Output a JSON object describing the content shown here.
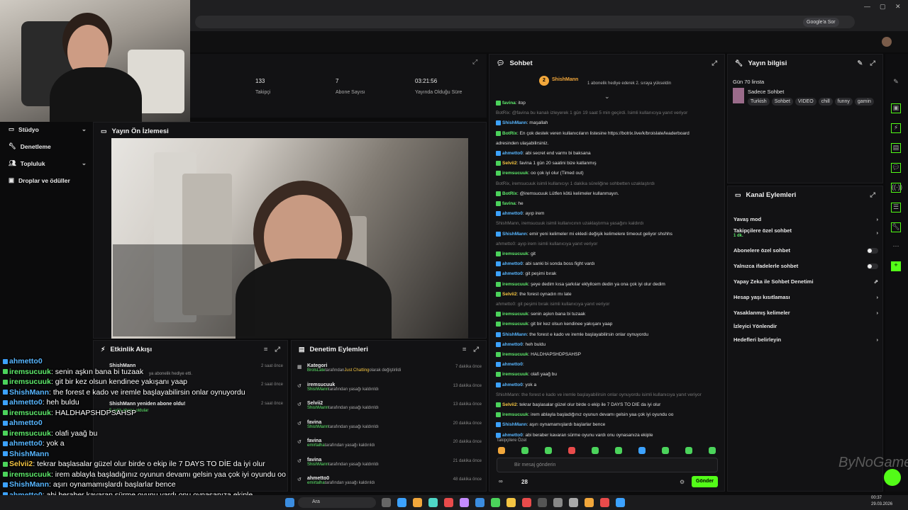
{
  "browser": {
    "google_sor": "Google'a Sor"
  },
  "stats": [
    {
      "value": "133",
      "label": "Takipçi"
    },
    {
      "value": "7",
      "label": "Abone Sayısı"
    },
    {
      "value": "03:21:56",
      "label": "Yayında Olduğu Süre"
    }
  ],
  "sidebar": {
    "items": [
      {
        "label": "Stüdyo"
      },
      {
        "label": "Denetleme"
      },
      {
        "label": "Topluluk"
      },
      {
        "label": "Droplar ve ödüller"
      }
    ]
  },
  "preview": {
    "title": "Yayın Ön İzlemesi"
  },
  "activity": {
    "title": "Etkinlik Akışı",
    "items": [
      {
        "user": "ShishMann",
        "text": "ya abonelik hediye etti.",
        "time": "2 saat önce"
      },
      {
        "user": "",
        "text": "",
        "time": "2 saat önce"
      },
      {
        "user": "ShishMann yeniden abone oldu!",
        "text": "5 aylık abone oldular",
        "time": "2 saat önce"
      }
    ]
  },
  "moderation": {
    "title": "Denetim Eylemleri",
    "items": [
      {
        "title": "Kategori",
        "sub_user": "BrolsLate",
        "sub": "tarafından",
        "sub_hl": "Just Chatting",
        "sub2": "olarak değiştirildi",
        "time": "7 dakika önce"
      },
      {
        "title": "iremsucuuk",
        "sub_user": "ShishMann",
        "sub": "tarafından yasağı kaldırıldı",
        "time": "13 dakika önce"
      },
      {
        "title": "Selvii2",
        "sub_user": "ShishMann",
        "sub": "tarafından yasağı kaldırıldı",
        "time": "13 dakika önce"
      },
      {
        "title": "favina",
        "sub_user": "ShishMann",
        "sub": "tarafından yasağı kaldırıldı",
        "time": "20 dakika önce"
      },
      {
        "title": "favina",
        "sub_user": "emirtalha",
        "sub": "tarafından yasağı kaldırıldı",
        "time": "20 dakika önce"
      },
      {
        "title": "favina",
        "sub_user": "ShishMann",
        "sub": "tarafından yasağı kaldırıldı",
        "time": "21 dakika önce"
      },
      {
        "title": "ahmetto0",
        "sub_user": "emirtalha",
        "sub": "tarafından yasağı kaldırıldı",
        "time": "48 dakika önce"
      }
    ]
  },
  "chat": {
    "title": "Sohbet",
    "pinned_user": "ShishMann",
    "pinned_count": "2",
    "pinned_text": "1 abonelik hediye ederek 2. sıraya yükseldin",
    "messages": [
      {
        "user": "favina",
        "text": "itop",
        "cls": "c-g"
      },
      {
        "sys": "BotRix: @favina bu kanalı izleyerek 1 gün 19 saat 5 min geçirdi. İsimli kullanıcıya yanıt veriyor"
      },
      {
        "user": "ShishMann",
        "text": "maşallah",
        "cls": "c-b"
      },
      {
        "user": "BotRix",
        "text": "En çok destek veren kullanıcıların listesine https://botrix.live/k/broislate/leaderboard",
        "cls": "c-g"
      },
      {
        "user": "",
        "text": "adresinden ulaşabilirsiniz.",
        "cls": ""
      },
      {
        "user": "ahmetto0",
        "text": "abi secret end varmı bi baksana",
        "cls": "c-b"
      },
      {
        "user": "Selvii2",
        "text": "favina 1 gün 20 saatini bize katlanmış",
        "cls": "c-y"
      },
      {
        "user": "iremsucuuk",
        "text": "oo çok iyi olur (Timed out)",
        "cls": "c-g"
      },
      {
        "sys": "BotRix, iremsucuuk isimli kullanıcıyı 1 dakika süreliğine sohbetten uzaklaştırdı"
      },
      {
        "user": "BotRix",
        "text": "@iremsucuuk Lütfen kötü kelimeler kullanmayın.",
        "cls": "c-g"
      },
      {
        "user": "favina",
        "text": "he",
        "cls": "c-g"
      },
      {
        "user": "ahmetto0",
        "text": "ayıp irem",
        "cls": "c-b"
      },
      {
        "sys": "ShishMann, iremsucuuk isimli kullanıcının uzaklaştırma yasağını kaldırdı"
      },
      {
        "user": "ShishMann",
        "text": "emir yeni kelimeler mi ekledi değişik kelimelere timeout geliyor shshhs",
        "cls": "c-b"
      },
      {
        "sys": "ahmetto0: ayıp irem isimli kullanıcıya yanıt veriyor"
      },
      {
        "user": "iremsucuuk",
        "text": "git",
        "cls": "c-g"
      },
      {
        "user": "ahmetto0",
        "text": "abi sanki bi sonda boss fight vardı",
        "cls": "c-b"
      },
      {
        "user": "ahmetto0",
        "text": "git peşimi bırak",
        "cls": "c-b"
      },
      {
        "user": "iremsucuuk",
        "text": "şeye dedim kısa şarkılar eklyilcem dedin ya ona çok iyi olur dedim",
        "cls": "c-g"
      },
      {
        "user": "Selvii2",
        "text": "the forest oynadın mı late",
        "cls": "c-y"
      },
      {
        "sys": "ahmetto0: git peşimi bırak isimli kullanıcıya yanıt veriyor"
      },
      {
        "user": "iremsucuuk",
        "text": "senin aşkın bana bi tuzaak",
        "cls": "c-g"
      },
      {
        "user": "iremsucuuk",
        "text": "git bir kez olsun kendinee yakışanı yaap",
        "cls": "c-g"
      },
      {
        "user": "ShishMann",
        "text": "the forest e kado ve iremle başlayabilirsin onlar oynuyordu",
        "cls": "c-b"
      },
      {
        "user": "ahmetto0",
        "text": "heh buldu",
        "cls": "c-b"
      },
      {
        "user": "iremsucuuk",
        "text": "HALDHAPSHDPSAHSP",
        "cls": "c-g"
      },
      {
        "user": "ahmetto0",
        "text": "",
        "cls": "c-b"
      },
      {
        "user": "iremsucuuk",
        "text": "olafi yaağ bu",
        "cls": "c-g"
      },
      {
        "user": "ahmetto0",
        "text": "yok a",
        "cls": "c-b"
      },
      {
        "sys": "ShishMann: the forest e kado ve iremle başlayabilirsin onlar oynuyordu isimli kullanıcıya yanıt veriyor"
      },
      {
        "user": "Selvii2",
        "text": "tekrar başlasalar güzel olur birde o ekip ile 7 DAYS TO DİE da iyi olur",
        "cls": "c-y"
      },
      {
        "user": "iremsucuuk",
        "text": "irem ablayla başladığınız oyunun devamı gelsin yaa çok iyi oyundu oo",
        "cls": "c-g"
      },
      {
        "user": "ShishMann",
        "text": "aşırı oynamamışlardı başlarlar bence",
        "cls": "c-b"
      },
      {
        "user": "ahmetto0",
        "text": "abi beraber kavaran sürme oyunu vardı onu oynasanıza ekiple",
        "cls": "c-b"
      }
    ],
    "followers_only": "Takipçilere Özel",
    "placeholder": "Bir mesaj gönderin",
    "count": "28",
    "send": "Gönder"
  },
  "info": {
    "title": "Yayın bilgisi",
    "stream_title": "Gün 70 linsta",
    "category": "Sadece Sohbet",
    "tags": [
      "Turkish",
      "Sohbet",
      "VIDEO",
      "chill",
      "funny",
      "gamin"
    ]
  },
  "kanal": {
    "title": "Kanal Eylemleri",
    "items": [
      {
        "label": "Yavaş mod",
        "kind": "chev"
      },
      {
        "label": "Takipçilere özel sohbet",
        "sub": "1 dk.",
        "kind": "chev"
      },
      {
        "label": "Abonelere özel sohbet",
        "kind": "toggle"
      },
      {
        "label": "Yalnızca ifadelerle sohbet",
        "kind": "toggle"
      },
      {
        "label": "Yapay Zeka ile Sohbet Denetimi",
        "kind": "ext"
      },
      {
        "label": "Hesap yaşı kısıtlaması",
        "kind": "chev"
      },
      {
        "label": "Yasaklanmış kelimeler",
        "kind": "chev"
      },
      {
        "label": "İzleyici Yönlendir",
        "kind": "none"
      },
      {
        "label": "Hedefleri belirleyin",
        "kind": "chev"
      }
    ]
  },
  "overlay": [
    {
      "user": "ahmetto0",
      "text": "",
      "cls": "c-b"
    },
    {
      "user": "iremsucuuk",
      "text": "senin aşkın bana bi tuzaak",
      "cls": "c-g"
    },
    {
      "user": "iremsucuuk",
      "text": "git bir kez olsun kendinee yakışanı yaap",
      "cls": "c-g"
    },
    {
      "user": "ShishMann",
      "text": "the forest e kado ve iremle başlayabilirsin onlar oynuyordu",
      "cls": "c-b"
    },
    {
      "user": "ahmetto0",
      "text": "heh buldu",
      "cls": "c-b"
    },
    {
      "user": "iremsucuuk",
      "text": "HALDHAPSHDPSAHSP",
      "cls": "c-g"
    },
    {
      "user": "ahmetto0",
      "text": "",
      "cls": "c-b"
    },
    {
      "user": "iremsucuuk",
      "text": "olafi yaağ bu",
      "cls": "c-g"
    },
    {
      "user": "ahmetto0",
      "text": "yok a",
      "cls": "c-b"
    },
    {
      "user": "ShishMann",
      "text": "",
      "cls": "c-b"
    },
    {
      "user": "Selvii2",
      "text": "tekrar başlasalar güzel olur birde o ekip ile 7 DAYS TO DİE da iyi olur",
      "cls": "c-y"
    },
    {
      "user": "iremsucuuk",
      "text": "irem ablayla başladığınız oyunun devamı gelsin yaa çok iyi oyundu oo",
      "cls": "c-g"
    },
    {
      "user": "ShishMann",
      "text": "aşırı oynamamışlardı başlarlar bence",
      "cls": "c-b"
    },
    {
      "user": "ahmetto0",
      "text": "abi beraber kavaran sürme oyunu vardı onu oynasanıza ekiple",
      "cls": "c-b"
    }
  ],
  "watermark": "ByNoGame",
  "taskbar": {
    "search": "Ara",
    "time": "00:37",
    "date": "29.03.2026"
  }
}
